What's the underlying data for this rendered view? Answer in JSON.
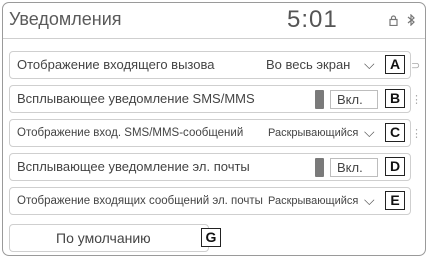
{
  "header": {
    "title": "Уведомления",
    "time": "5:01",
    "status_icons": [
      "lock-icon",
      "bluetooth-icon"
    ]
  },
  "rows": [
    {
      "label": "Отображение входящего вызова",
      "value": "Во весь экран",
      "type": "dropdown",
      "callout": "A"
    },
    {
      "label": "Всплывающее уведомление SMS/MMS",
      "value": "Вкл.",
      "type": "toggle",
      "state": "on",
      "callout": "B"
    },
    {
      "label": "Отображение вход. SMS/MMS-сообщений",
      "value": "Раскрывающийся",
      "type": "dropdown",
      "callout": "C"
    },
    {
      "label": "Всплывающее уведомление эл. почты",
      "value": "Вкл.",
      "type": "toggle",
      "state": "on",
      "callout": "D"
    },
    {
      "label": "Отображение входящих сообщений эл. почты",
      "value": "Раскрывающийся",
      "type": "dropdown",
      "callout": "E"
    }
  ],
  "default_button": {
    "label": "По умолчанию",
    "callout": "G"
  }
}
